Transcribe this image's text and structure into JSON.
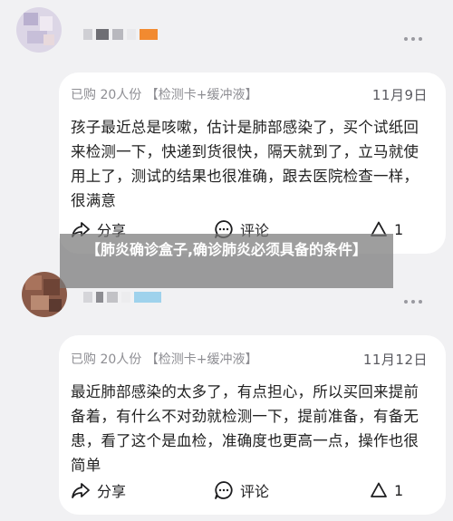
{
  "banner": {
    "title": "【肺炎确诊盒子,确诊肺炎必须具备的条件】"
  },
  "reviews": [
    {
      "meta": "已购 20人份 【检测卡+缓冲液】",
      "date": "11月9日",
      "text": "孩子最近总是咳嗽，估计是肺部感染了，买个试纸回来检测一下，快递到货很快，隔天就到了，立马就使用上了，测试的结果也很准确，跟去医院检查一样，很满意",
      "share_label": "分享",
      "comment_label": "评论",
      "like_count": "1"
    },
    {
      "meta": "已购 20人份 【检测卡+缓冲液】",
      "date": "11月12日",
      "text": "最近肺部感染的太多了，有点担心，所以买回来提前备着，有什么不对劲就检测一下，提前准备，有备无患，看了这个是血检，准确度也更高一点，操作也很简单",
      "share_label": "分享",
      "comment_label": "评论",
      "like_count": "1"
    }
  ],
  "icons": {
    "share": "share-icon",
    "comment": "comment-icon",
    "like": "like-icon",
    "more": "more-icon"
  },
  "colors": {
    "page_bg": "#f1f1f3",
    "card_bg": "#ffffff",
    "banner_bg": "#787878",
    "muted_text": "#8e8e93"
  }
}
